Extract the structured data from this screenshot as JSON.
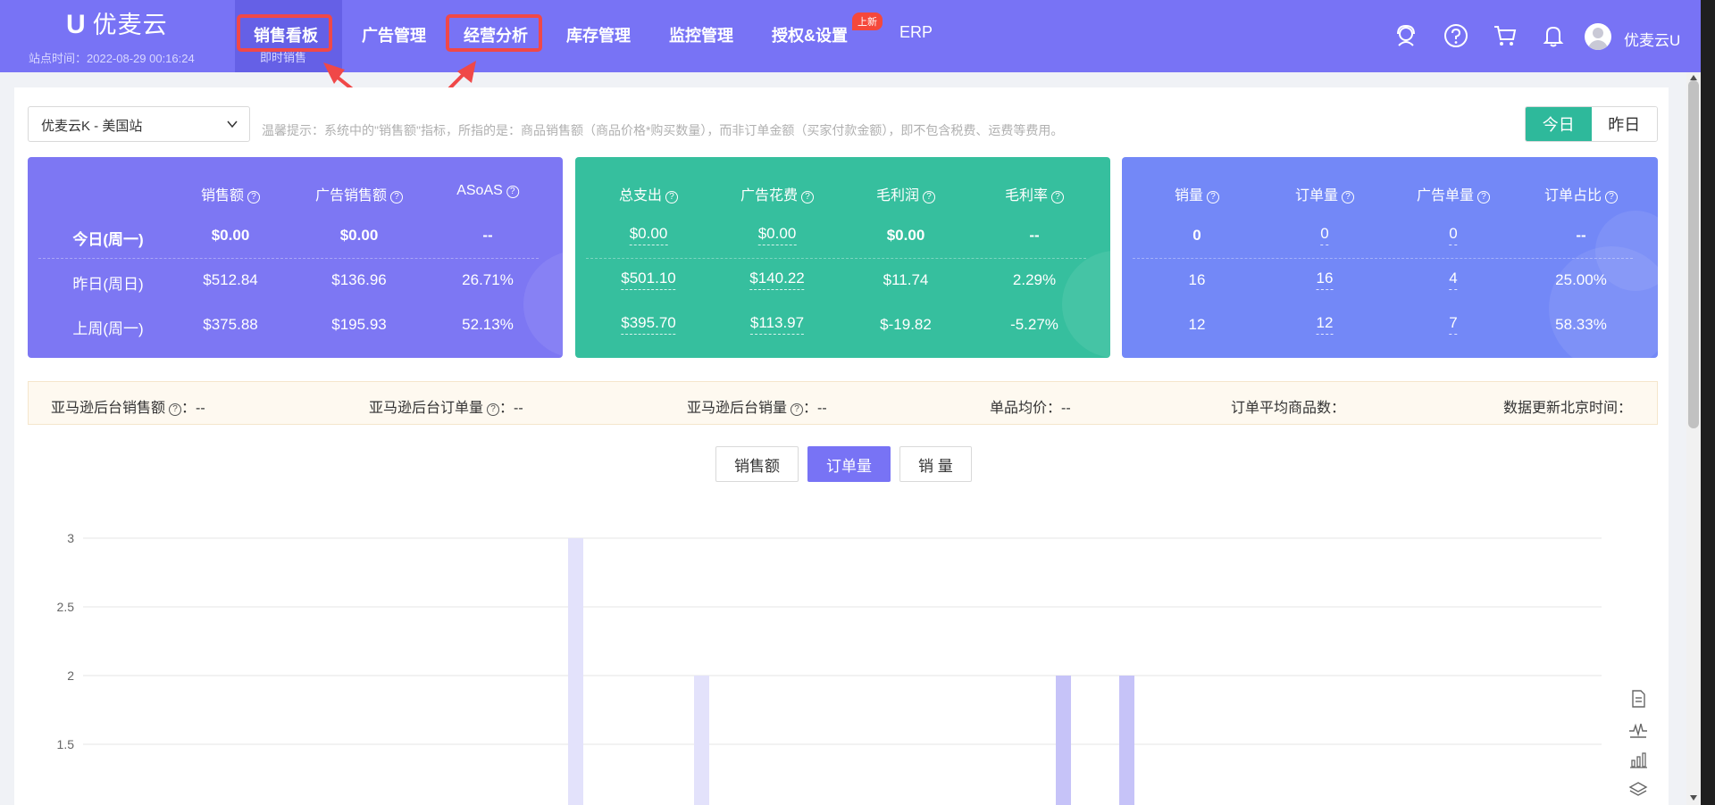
{
  "app": {
    "logo_mark": "U",
    "name": "优麦云",
    "site_time": "站点时间：2022-08-29 00:16:24",
    "username": "优麦云U"
  },
  "nav": {
    "items": [
      "销售看板",
      "广告管理",
      "经营分析",
      "库存管理",
      "监控管理",
      "授权&设置",
      "ERP"
    ],
    "active_sub": "即时销售",
    "new_badge": "上新"
  },
  "toolbar": {
    "store": "优麦云K - 美国站",
    "tip": "温馨提示：系统中的\"销售额\"指标，所指的是：商品销售额（商品价格*购买数量），而非订单金额（买家付款金额），即不包含税费、运费等费用。",
    "today": "今日",
    "yesterday": "昨日"
  },
  "rows": [
    "今日(周一)",
    "昨日(周日)",
    "上周(周一)"
  ],
  "card_sales": {
    "color": "#7d77f3",
    "headers": [
      "销售额",
      "广告销售额",
      "ASoAS"
    ],
    "values": [
      [
        "$0.00",
        "$0.00",
        "--"
      ],
      [
        "$512.84",
        "$136.96",
        "26.71%"
      ],
      [
        "$375.88",
        "$195.93",
        "52.13%"
      ]
    ]
  },
  "card_cost": {
    "color": "#36bf9e",
    "headers": [
      "总支出",
      "广告花费",
      "毛利润",
      "毛利率"
    ],
    "values": [
      [
        "$0.00",
        "$0.00",
        "$0.00",
        "--"
      ],
      [
        "$501.10",
        "$140.22",
        "$11.74",
        "2.29%"
      ],
      [
        "$395.70",
        "$113.97",
        "$-19.82",
        "-5.27%"
      ]
    ]
  },
  "card_orders": {
    "color": "#7388f7",
    "headers": [
      "销量",
      "订单量",
      "广告单量",
      "订单占比"
    ],
    "values": [
      [
        "0",
        "0",
        "0",
        "--"
      ],
      [
        "16",
        "16",
        "4",
        "25.00%"
      ],
      [
        "12",
        "12",
        "7",
        "58.33%"
      ]
    ]
  },
  "summary": {
    "amazon_sales": "亚马逊后台销售额",
    "amazon_orders": "亚马逊后台订单量",
    "amazon_units": "亚马逊后台销量",
    "unit_price": "单品均价：",
    "avg_items": "订单平均商品数：",
    "update_time": "数据更新北京时间：",
    "colon_value": "：--",
    "dash": "--"
  },
  "metric_tabs": [
    "销售额",
    "订单量",
    "销 量"
  ],
  "chart_data": {
    "type": "bar",
    "yticks": [
      "3",
      "2.5",
      "2",
      "1.5"
    ],
    "ylim": [
      1.5,
      3
    ],
    "grid": true,
    "bars": [
      {
        "x_index": 0,
        "value": 3,
        "color": "#e3e2fb"
      },
      {
        "x_index": 1,
        "value": 2,
        "color": "#e3e2fb"
      },
      {
        "x_index": 2,
        "value": 2,
        "color": "#c6c3f8"
      },
      {
        "x_index": 3,
        "value": 2,
        "color": "#c6c3f8"
      }
    ]
  }
}
